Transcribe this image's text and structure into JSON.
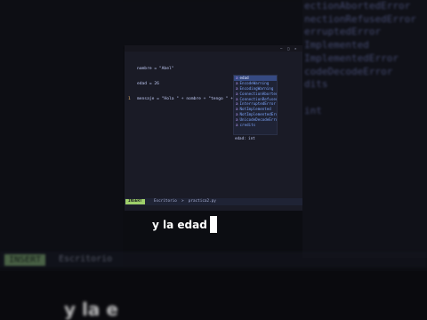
{
  "editor": {
    "lines": [
      {
        "num": "",
        "code": "nombre = \"Abel\""
      },
      {
        "num": "",
        "code": "edad = 26"
      },
      {
        "num": "1",
        "code": "mensaje = \"Hola \" + nombre + \"tengo \" + str(ed )"
      }
    ]
  },
  "completion": {
    "items": [
      {
        "label": "edad",
        "kind": "a",
        "selected": true
      },
      {
        "label": "EncodeWarning",
        "kind": "a"
      },
      {
        "label": "EncodingWarning",
        "kind": "a"
      },
      {
        "label": "ConnectionAbortedError",
        "kind": "a"
      },
      {
        "label": "ConnectionRefusedError",
        "kind": "a"
      },
      {
        "label": "InterruptedError",
        "kind": "a"
      },
      {
        "label": "NotImplemented",
        "kind": "a"
      },
      {
        "label": "NotImplementedError",
        "kind": "a"
      },
      {
        "label": "UnicodeDecodeError",
        "kind": "a"
      },
      {
        "label": "credits",
        "kind": "a"
      }
    ],
    "hint": "edad: int"
  },
  "status": {
    "mode": "INSERT",
    "path": "Escritorio  >  practica2.py"
  },
  "caption": {
    "text": "y la edad"
  },
  "background": {
    "ghost_list": "ectionAbortedError\nnectionRefusedError\nerruptedError\nImplemented\nImplementedError\ncodeDecodeError\ndits\n\nint",
    "ghost_mode": "INSERT",
    "ghost_path": "Escritorio",
    "ghost_caption": "y la e"
  }
}
